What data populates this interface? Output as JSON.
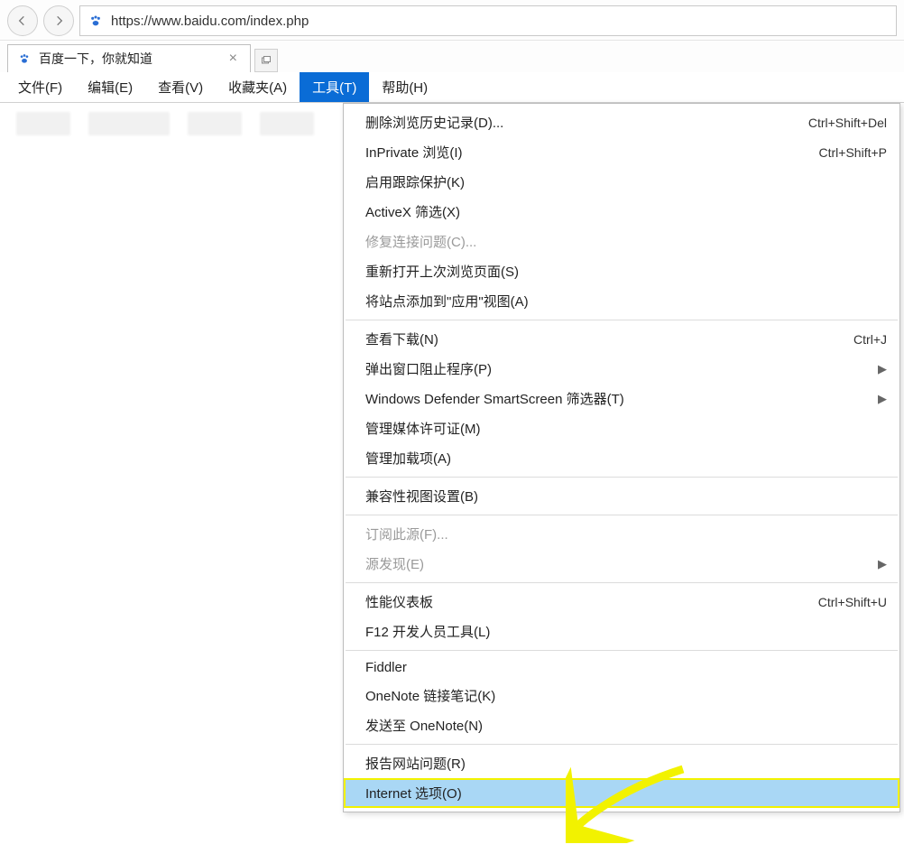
{
  "nav": {
    "url": "https://www.baidu.com/index.php"
  },
  "tab": {
    "title": "百度一下，你就知道"
  },
  "menubar": {
    "items": [
      "文件(F)",
      "编辑(E)",
      "查看(V)",
      "收藏夹(A)",
      "工具(T)",
      "帮助(H)"
    ],
    "active_index": 4
  },
  "tools_menu": {
    "groups": [
      [
        {
          "label": "删除浏览历史记录(D)...",
          "shortcut": "Ctrl+Shift+Del"
        },
        {
          "label": "InPrivate 浏览(I)",
          "shortcut": "Ctrl+Shift+P"
        },
        {
          "label": "启用跟踪保护(K)"
        },
        {
          "label": "ActiveX 筛选(X)"
        },
        {
          "label": "修复连接问题(C)...",
          "disabled": true
        },
        {
          "label": "重新打开上次浏览页面(S)"
        },
        {
          "label": "将站点添加到\"应用\"视图(A)"
        }
      ],
      [
        {
          "label": "查看下载(N)",
          "shortcut": "Ctrl+J"
        },
        {
          "label": "弹出窗口阻止程序(P)",
          "submenu": true
        },
        {
          "label": "Windows Defender SmartScreen 筛选器(T)",
          "submenu": true
        },
        {
          "label": "管理媒体许可证(M)"
        },
        {
          "label": "管理加载项(A)"
        }
      ],
      [
        {
          "label": "兼容性视图设置(B)"
        }
      ],
      [
        {
          "label": "订阅此源(F)...",
          "disabled": true
        },
        {
          "label": "源发现(E)",
          "disabled": true,
          "submenu": true
        }
      ],
      [
        {
          "label": "性能仪表板",
          "shortcut": "Ctrl+Shift+U"
        },
        {
          "label": "F12 开发人员工具(L)"
        }
      ],
      [
        {
          "label": "Fiddler"
        },
        {
          "label": "OneNote 链接笔记(K)"
        },
        {
          "label": "发送至 OneNote(N)"
        }
      ],
      [
        {
          "label": "报告网站问题(R)"
        },
        {
          "label": "Internet 选项(O)",
          "highlight": true
        }
      ]
    ]
  }
}
